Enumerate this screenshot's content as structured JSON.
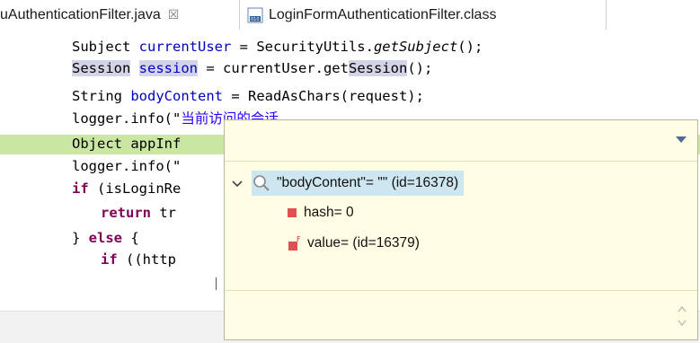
{
  "tabs": [
    {
      "label": "uAuthenticationFilter.java",
      "close": "☒"
    },
    {
      "label": "LoginFormAuthenticationFilter.class"
    }
  ],
  "code": {
    "line1": {
      "type": "Subject",
      "var": "currentUser",
      "eq": " = SecurityUtils.",
      "call": "getSubject",
      "end": "();"
    },
    "line2": {
      "type": "Session",
      "var": "session",
      "eq": " = currentUser.get",
      "call": "Session",
      "end": "();"
    },
    "line3": {
      "type": "String",
      "var": "bodyContent",
      "eq": " = ReadAsChars(request);"
    },
    "line4": {
      "pre": "logger.info(\"",
      "cjk": "当前访问的会话"
    },
    "line5": {
      "text": "Object appInf"
    },
    "line6": {
      "text": "logger.info(\""
    },
    "line7": {
      "kw": "if",
      "text": " (isLoginRe"
    },
    "line8": {
      "kw": "return",
      "text": " tr"
    },
    "line9": {
      "kw": "else",
      "pre": "} ",
      "text": " {"
    },
    "line10": {
      "kw": "if",
      "text": " ((http"
    }
  },
  "popup": {
    "row1": "\"bodyContent\"= \"\" (id=16378)",
    "row2": "hash= 0",
    "row3": "value= (id=16379)",
    "accent": "#fffde4"
  }
}
